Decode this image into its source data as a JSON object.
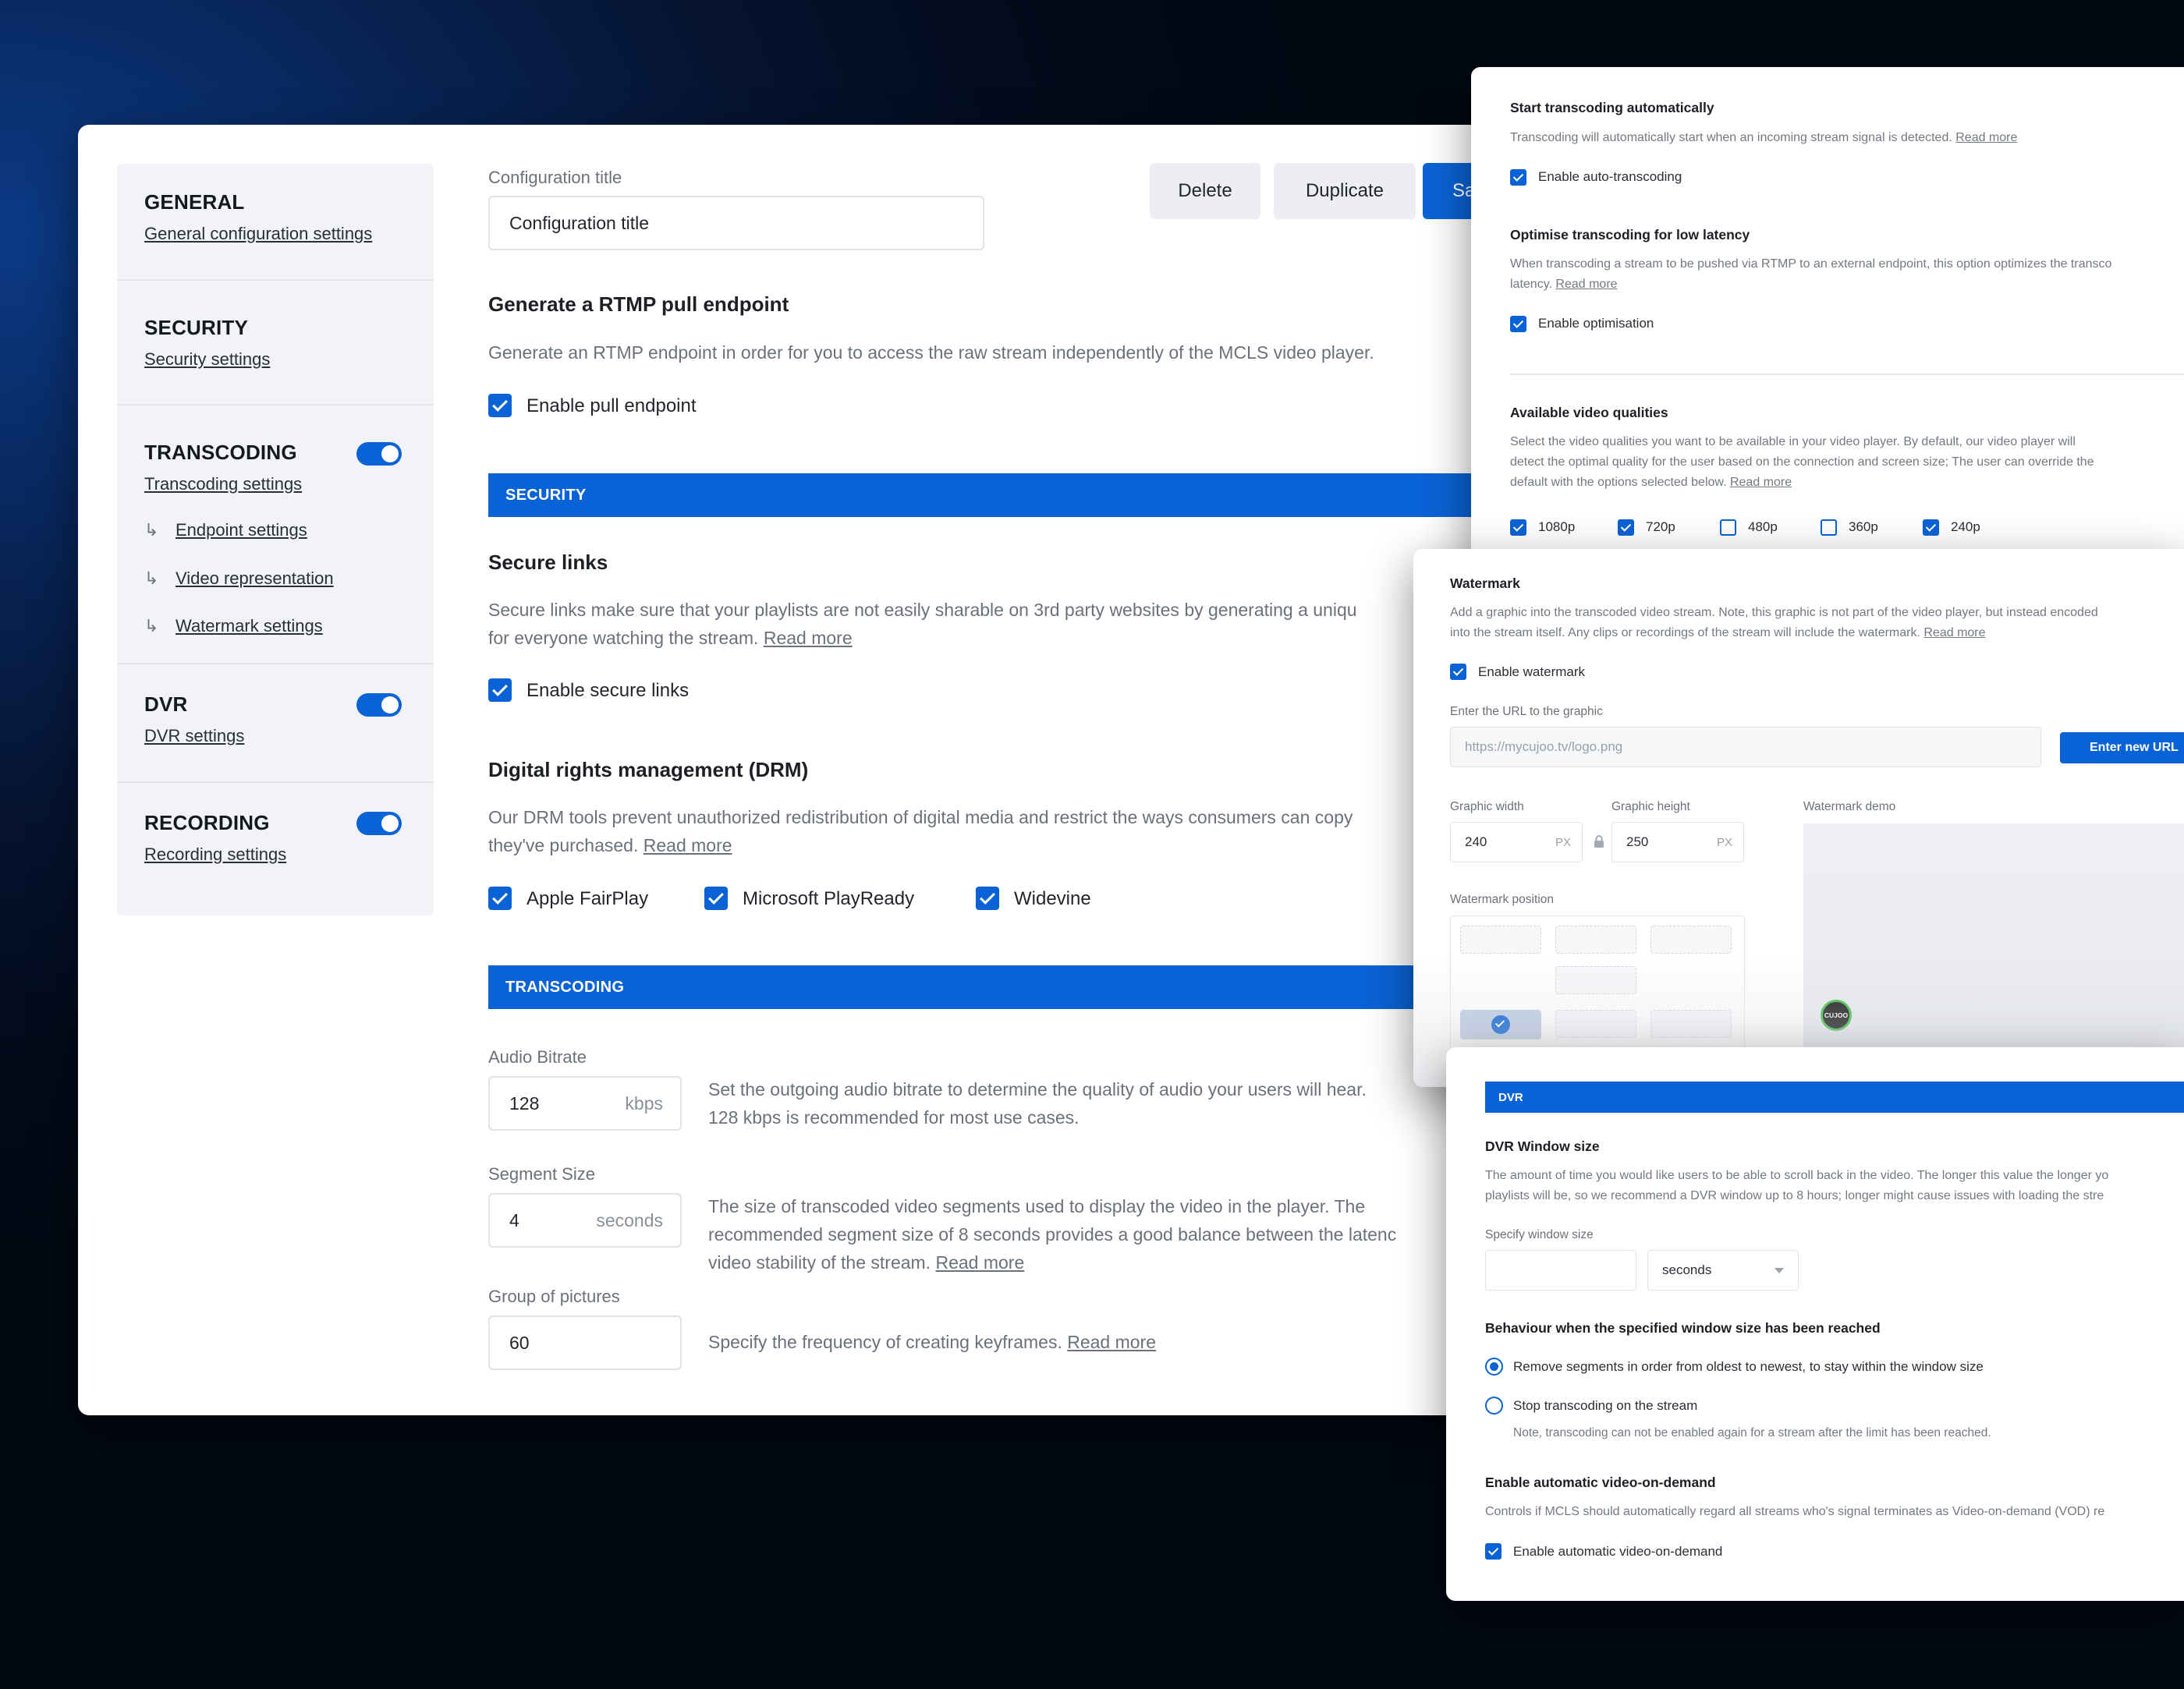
{
  "sidebar": {
    "general": {
      "title": "GENERAL",
      "link": "General configuration settings"
    },
    "security": {
      "title": "SECURITY",
      "link": "Security settings"
    },
    "transcoding": {
      "title": "TRANSCODING",
      "link": "Transcoding settings",
      "subitems": [
        "Endpoint settings",
        "Video representation",
        "Watermark settings"
      ],
      "enabled": true
    },
    "dvr": {
      "title": "DVR",
      "link": "DVR settings",
      "enabled": true
    },
    "recording": {
      "title": "RECORDING",
      "link": "Recording settings",
      "enabled": true
    },
    "sub_arrow": "↳"
  },
  "header": {
    "config_label": "Configuration title",
    "config_value": "Configuration title",
    "delete": "Delete",
    "duplicate": "Duplicate",
    "save": "Sa"
  },
  "rtmp": {
    "title": "Generate a RTMP pull endpoint",
    "desc": "Generate an RTMP endpoint in order for you to access the raw stream independently of the MCLS video player.",
    "checkbox": "Enable pull endpoint"
  },
  "security_section": {
    "bar": "SECURITY",
    "secure_links": {
      "title": "Secure links",
      "desc_line1": "Secure links make sure that your playlists are not easily sharable on 3rd party websites by generating a uniqu",
      "desc_line2": "for everyone watching the stream.",
      "read_more": "Read more",
      "checkbox": "Enable secure links"
    },
    "drm": {
      "title": "Digital rights management (DRM)",
      "desc_line1": "Our DRM tools prevent unauthorized redistribution of digital media and restrict the ways consumers can copy",
      "desc_line2": "they've purchased.",
      "read_more": "Read more",
      "options": [
        "Apple FairPlay",
        "Microsoft PlayReady",
        "Widevine"
      ]
    }
  },
  "transcoding_section": {
    "bar": "TRANSCODING",
    "audio": {
      "label": "Audio Bitrate",
      "value": "128",
      "unit": "kbps",
      "desc_line1": "Set the outgoing audio bitrate to determine the quality of audio your users will hear.",
      "desc_line2": "128 kbps is recommended for most use cases."
    },
    "segment": {
      "label": "Segment Size",
      "value": "4",
      "unit": "seconds",
      "desc_line1": "The size of transcoded video segments used to display the video in the player. The",
      "desc_line2": "recommended segment size of 8 seconds provides a good balance between the latenc",
      "desc_line3": "video stability of the stream.",
      "read_more": "Read more"
    },
    "gop": {
      "label": "Group of pictures",
      "value": "60",
      "desc": "Specify the frequency of creating keyframes.",
      "read_more": "Read more"
    }
  },
  "transcode_panel": {
    "auto": {
      "title": "Start transcoding automatically",
      "desc": "Transcoding will automatically start when an incoming stream signal is detected.",
      "read_more": "Read more",
      "checkbox": "Enable auto-transcoding"
    },
    "latency": {
      "title": "Optimise transcoding for low latency",
      "desc_line1": "When transcoding a stream to be pushed via RTMP to an external endpoint, this option optimizes the transco",
      "desc_line2": "latency.",
      "read_more": "Read more",
      "checkbox": "Enable optimisation"
    },
    "qualities": {
      "title": "Available video qualities",
      "desc_line1": "Select the video qualities you want to be available in your video player. By default, our video player will",
      "desc_line2": "detect the optimal quality for the user based on the connection and screen size; The user can override the",
      "desc_line3": "default with the options selected below.",
      "read_more": "Read more",
      "options": [
        {
          "label": "1080p",
          "checked": true
        },
        {
          "label": "720p",
          "checked": true
        },
        {
          "label": "480p",
          "checked": false
        },
        {
          "label": "360p",
          "checked": false
        },
        {
          "label": "240p",
          "checked": true
        }
      ]
    }
  },
  "watermark_panel": {
    "title": "Watermark",
    "desc_line1": "Add a graphic into the transcoded video stream. Note, this graphic is not part of the video player, but instead encoded",
    "desc_line2": "into the stream itself. Any clips or recordings of the stream will include the watermark.",
    "read_more": "Read more",
    "checkbox": "Enable watermark",
    "url_label": "Enter the URL to the graphic",
    "url_placeholder": "https://mycujoo.tv/logo.png",
    "url_button": "Enter new URL",
    "width_label": "Graphic width",
    "width_value": "240",
    "width_unit": "PX",
    "height_label": "Graphic height",
    "height_value": "250",
    "height_unit": "PX",
    "demo_label": "Watermark demo",
    "position_label": "Watermark position",
    "logo_text": "CUJOO"
  },
  "dvr_panel": {
    "bar": "DVR",
    "title": "DVR Window size",
    "desc_line1": "The amount of time you would like users to be able to scroll back in the video. The longer this value the longer yo",
    "desc_line2": "playlists will be, so we recommend a DVR window up to 8 hours; longer might cause issues with loading the stre",
    "specify_label": "Specify window size",
    "window_value": "",
    "unit_select": "seconds",
    "behaviour_title": "Behaviour when the specified window size has been reached",
    "radio1": "Remove segments in order from oldest to newest, to stay within the window size",
    "radio2": "Stop transcoding on the stream",
    "radio2_note": "Note, transcoding can not be enabled again for a stream after the limit has been reached.",
    "vod_title": "Enable automatic video-on-demand",
    "vod_desc": "Controls if MCLS should automatically regard all streams who's signal terminates as Video-on-demand (VOD) re",
    "vod_checkbox": "Enable automatic video-on-demand"
  },
  "colors": {
    "accent": "#0a63d6",
    "background": "#061533",
    "panel": "#ffffff"
  },
  "icons": {
    "checkbox": "checkmark-icon",
    "lock": "lock-icon",
    "dropdown": "chevron-down-icon"
  }
}
